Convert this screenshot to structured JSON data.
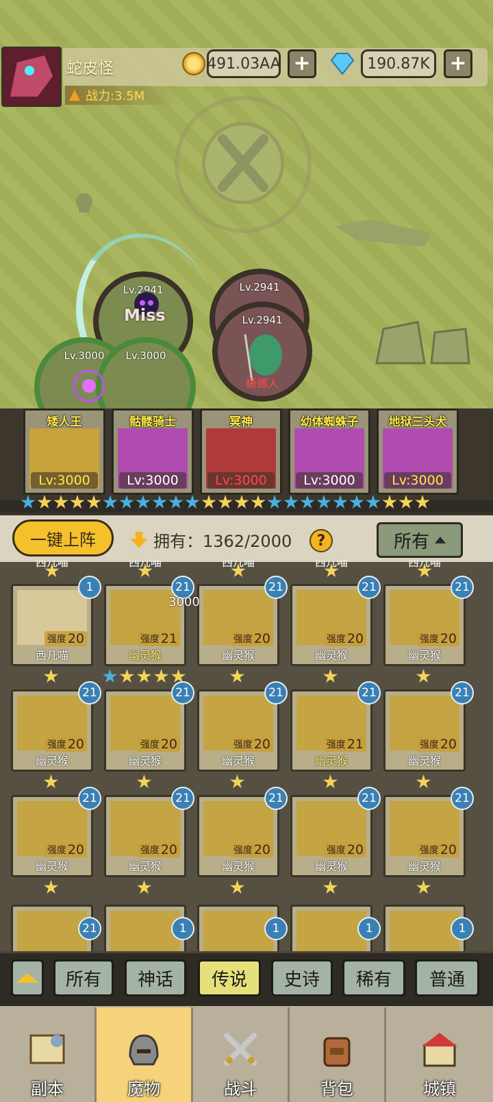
{
  "player": {
    "name": "蛇皮怪",
    "power": "战力:3.5M"
  },
  "resources": {
    "coins": "491.03AA",
    "gems": "190.87K",
    "add_label": "+"
  },
  "battle": {
    "miss_text": "Miss",
    "enemies": [
      {
        "level": "Lv.2941",
        "name": ""
      },
      {
        "level": "Lv.2941",
        "name": "蜥蜴人"
      }
    ],
    "allies": [
      {
        "level": "Lv.3000"
      },
      {
        "level": "Lv.3000"
      },
      {
        "level": "Lv.2941"
      }
    ]
  },
  "team": [
    {
      "name": "矮人王",
      "level": "Lv:3000",
      "level_color": "#ffe94a"
    },
    {
      "name": "骷髅骑士",
      "level": "Lv:3000",
      "level_color": "#ffffff"
    },
    {
      "name": "冥神",
      "level": "Lv:3000",
      "level_color": "#ff4a4a"
    },
    {
      "name": "幼体蜘蛛子",
      "level": "Lv:3000",
      "level_color": "#ffffff"
    },
    {
      "name": "地狱三头犬",
      "level": "Lv:3000",
      "level_color": "#ffe94a"
    }
  ],
  "toolbar": {
    "deploy_label": "一键上阵",
    "owned_label": "拥有：1362/2000",
    "help": "?",
    "filter_label": "所有"
  },
  "float_number": "3000",
  "partial_row_label": "西几喵",
  "monsters": {
    "row1": [
      {
        "name": "西几喵",
        "strength_label": "强度",
        "strength": "20",
        "badge": "1",
        "stars": 1,
        "blue_stars": 0
      },
      {
        "name": "幽灵猴",
        "strength_label": "强度",
        "strength": "21",
        "badge": "21",
        "stars": 4,
        "blue_stars": 1
      },
      {
        "name": "幽灵猴",
        "strength_label": "强度",
        "strength": "20",
        "badge": "21",
        "stars": 1,
        "blue_stars": 0
      },
      {
        "name": "幽灵猴",
        "strength_label": "强度",
        "strength": "20",
        "badge": "21",
        "stars": 1,
        "blue_stars": 0
      },
      {
        "name": "幽灵猴",
        "strength_label": "强度",
        "strength": "20",
        "badge": "21",
        "stars": 1,
        "blue_stars": 0
      }
    ],
    "row2": [
      {
        "name": "幽灵猴",
        "strength_label": "强度",
        "strength": "20",
        "badge": "21"
      },
      {
        "name": "幽灵猴",
        "strength_label": "强度",
        "strength": "20",
        "badge": "21"
      },
      {
        "name": "幽灵猴",
        "strength_label": "强度",
        "strength": "20",
        "badge": "21"
      },
      {
        "name": "幽灵猴",
        "strength_label": "强度",
        "strength": "21",
        "badge": "21"
      },
      {
        "name": "幽灵猴",
        "strength_label": "强度",
        "strength": "20",
        "badge": "21"
      }
    ],
    "row3": [
      {
        "name": "幽灵猴",
        "strength_label": "强度",
        "strength": "20",
        "badge": "21"
      },
      {
        "name": "幽灵猴",
        "strength_label": "强度",
        "strength": "20",
        "badge": "21"
      },
      {
        "name": "幽灵猴",
        "strength_label": "强度",
        "strength": "20",
        "badge": "21"
      },
      {
        "name": "幽灵猴",
        "strength_label": "强度",
        "strength": "20",
        "badge": "21"
      },
      {
        "name": "幽灵猴",
        "strength_label": "强度",
        "strength": "20",
        "badge": "21"
      }
    ],
    "row4_badges": [
      "21",
      "1",
      "1",
      "1",
      "1"
    ]
  },
  "rarity_tabs": [
    "所有",
    "神话",
    "传说",
    "史诗",
    "稀有",
    "普通"
  ],
  "active_rarity": "传说",
  "nav": [
    {
      "label": "副本",
      "icon": "map-icon"
    },
    {
      "label": "魔物",
      "icon": "helmet-icon"
    },
    {
      "label": "战斗",
      "icon": "swords-icon"
    },
    {
      "label": "背包",
      "icon": "backpack-icon"
    },
    {
      "label": "城镇",
      "icon": "town-icon"
    }
  ],
  "active_nav": "魔物",
  "colors": {
    "gold": "#f4c12c",
    "badge_blue": "#3a80b4",
    "enemy_name": "#ff4a4a"
  }
}
